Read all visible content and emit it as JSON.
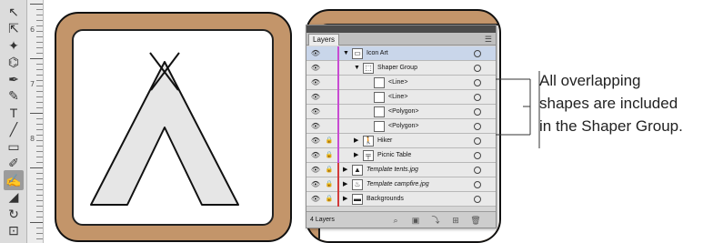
{
  "tools": [
    {
      "name": "direct-selection-tool",
      "glyph": "↖"
    },
    {
      "name": "group-selection-tool",
      "glyph": "⇱"
    },
    {
      "name": "magic-wand-tool",
      "glyph": "✦"
    },
    {
      "name": "lasso-tool",
      "glyph": "⌬"
    },
    {
      "name": "pen-tool",
      "glyph": "✒"
    },
    {
      "name": "curvature-tool",
      "glyph": "✎"
    },
    {
      "name": "type-tool",
      "glyph": "T"
    },
    {
      "name": "line-segment-tool",
      "glyph": "╱"
    },
    {
      "name": "rectangle-tool",
      "glyph": "▭"
    },
    {
      "name": "paintbrush-tool",
      "glyph": "✐"
    },
    {
      "name": "shaper-tool",
      "glyph": "✍"
    },
    {
      "name": "eraser-tool",
      "glyph": "◢"
    },
    {
      "name": "rotate-tool",
      "glyph": "↻"
    },
    {
      "name": "scale-tool",
      "glyph": "⊡"
    }
  ],
  "ruler": {
    "labels": [
      "6",
      "7",
      "8"
    ]
  },
  "layers_panel": {
    "tab_label": "Layers",
    "menu_icon": "☰",
    "rows": [
      {
        "name": "Icon Art",
        "level": 0,
        "arrow": "▼",
        "italic": false,
        "lock": false,
        "selected": true,
        "bar": "#c84bd2",
        "thumb": "▭"
      },
      {
        "name": "Shaper Group",
        "level": 1,
        "arrow": "▼",
        "italic": false,
        "lock": false,
        "selected": false,
        "bar": "#c84bd2",
        "thumb": "⬚"
      },
      {
        "name": "<Line>",
        "level": 2,
        "arrow": "",
        "italic": false,
        "lock": false,
        "selected": false,
        "bar": "#c84bd2",
        "thumb": ""
      },
      {
        "name": "<Line>",
        "level": 2,
        "arrow": "",
        "italic": false,
        "lock": false,
        "selected": false,
        "bar": "#c84bd2",
        "thumb": ""
      },
      {
        "name": "<Polygon>",
        "level": 2,
        "arrow": "",
        "italic": false,
        "lock": false,
        "selected": false,
        "bar": "#c84bd2",
        "thumb": ""
      },
      {
        "name": "<Polygon>",
        "level": 2,
        "arrow": "",
        "italic": false,
        "lock": false,
        "selected": false,
        "bar": "#c84bd2",
        "thumb": ""
      },
      {
        "name": "Hiker",
        "level": 1,
        "arrow": "▶",
        "italic": false,
        "lock": true,
        "selected": false,
        "bar": "#c84bd2",
        "thumb": "🚶"
      },
      {
        "name": "Picnic Table",
        "level": 1,
        "arrow": "▶",
        "italic": false,
        "lock": true,
        "selected": false,
        "bar": "#c84bd2",
        "thumb": "╤"
      },
      {
        "name": "Template tents.jpg",
        "level": 0,
        "arrow": "▶",
        "italic": true,
        "lock": true,
        "selected": false,
        "bar": "#d23a3a",
        "thumb": "▲"
      },
      {
        "name": "Template campfire.jpg",
        "level": 0,
        "arrow": "▶",
        "italic": true,
        "lock": true,
        "selected": false,
        "bar": "#d23a3a",
        "thumb": "♨"
      },
      {
        "name": "Backgrounds",
        "level": 0,
        "arrow": "▶",
        "italic": false,
        "lock": true,
        "selected": false,
        "bar": "#d23a3a",
        "thumb": "▬"
      }
    ],
    "status_count": "4 Layers",
    "status_icons": [
      {
        "name": "locate-object-icon",
        "glyph": "⌕"
      },
      {
        "name": "clipping-mask-icon",
        "glyph": "▣"
      },
      {
        "name": "new-sublayer-icon",
        "glyph": "⤵"
      },
      {
        "name": "new-layer-icon",
        "glyph": "⊞"
      },
      {
        "name": "delete-layer-icon",
        "glyph": "🗑"
      }
    ]
  },
  "callout": {
    "line1": "All overlapping",
    "line2": "shapes are included",
    "line3": "in the Shaper Group."
  },
  "colors": {
    "frame_fill": "#c3956a",
    "tent_fill": "#e6e6e6",
    "selection_row": "#c9d6ea"
  }
}
